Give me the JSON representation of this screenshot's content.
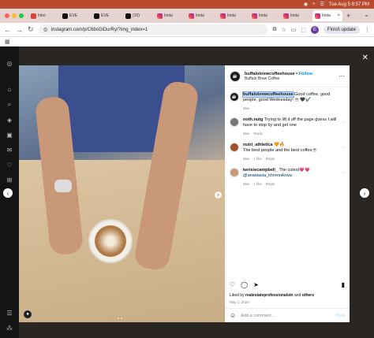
{
  "menubar": {
    "date_time": "Tue Aug 5  8:57 PM"
  },
  "tabs": [
    {
      "label": "Inbo",
      "icon": "gmail-icon"
    },
    {
      "label": "EVE",
      "icon": "x-icon"
    },
    {
      "label": "EVE",
      "icon": "x-icon"
    },
    {
      "label": "(10)",
      "icon": "x-icon"
    },
    {
      "label": "Insta",
      "icon": "instagram-icon"
    },
    {
      "label": "Insta",
      "icon": "instagram-icon"
    },
    {
      "label": "Insta",
      "icon": "instagram-icon"
    },
    {
      "label": "Insta",
      "icon": "instagram-icon"
    },
    {
      "label": "Insta",
      "icon": "instagram-icon"
    },
    {
      "label": "Insta",
      "icon": "instagram-icon",
      "active": true
    }
  ],
  "address": {
    "url": "instagram.com/p/C6bsGiDurRy/?img_index=1",
    "profile_initial": "E",
    "finish_update": "Finish update"
  },
  "post": {
    "username": "buffalobrewcoffeehouse",
    "follow": "Follow",
    "location": "Buffalo Brew Coffee",
    "caption_user": "buffalobrewcoffeehouse",
    "caption_text": "Good coffee, good people, good Wednesday! ☕️🖤✔️",
    "caption_age": "65w",
    "comments": [
      {
        "user": "noth.nutg",
        "text": "Trying to lift it off the page guess I will have to stop by and get one",
        "age": "65w",
        "likes": "",
        "reply": "Reply"
      },
      {
        "user": "nutri_athletica",
        "text": "🧡🔥",
        "text2": "The best people and the best coffee☕️",
        "age": "65w",
        "likes": "1 like",
        "reply": "Reply"
      },
      {
        "user": "kensiecampbell_",
        "text": "The cutest💗💗",
        "mention": "@anastasia_khrennikova",
        "age": "65w",
        "likes": "1 like",
        "reply": "Reply"
      }
    ],
    "liked_by_prefix": "Liked by ",
    "liked_by_user": "realestateprofessionalstn",
    "liked_by_suffix": " and ",
    "liked_by_others": "others",
    "date": "May 1, 2024",
    "add_comment_placeholder": "Add a comment...",
    "post_label": "Post"
  }
}
